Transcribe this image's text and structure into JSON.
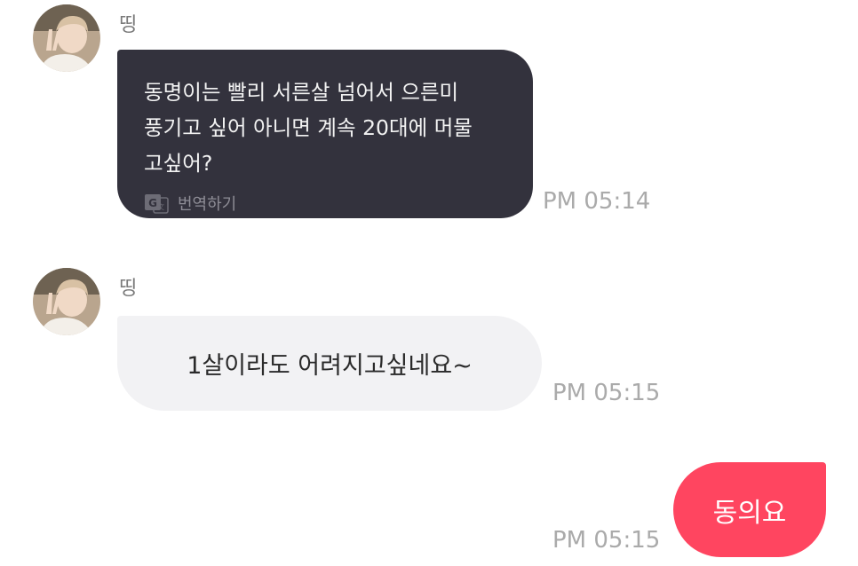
{
  "colors": {
    "dark_bubble": "#33323d",
    "light_bubble": "#f2f2f4",
    "pink_bubble": "#ff4560",
    "timestamp": "#aaaaaa",
    "sender_name": "#7a7a7a"
  },
  "messages": [
    {
      "sender": "띵",
      "avatar_icon": "profile-photo",
      "lines": [
        "동명이는 빨리 서른살 넘어서 으른미",
        "풍기고 싶어 아니면 계속 20대에 머물",
        "고싶어?"
      ],
      "translate_icon": "translate-icon",
      "translate_label": "번역하기",
      "time": "PM 05:14"
    },
    {
      "sender": "띵",
      "avatar_icon": "profile-photo",
      "text": "1살이라도 어려지고싶네요~",
      "time": "PM 05:15"
    },
    {
      "text": "동의요",
      "time": "PM 05:15"
    }
  ]
}
